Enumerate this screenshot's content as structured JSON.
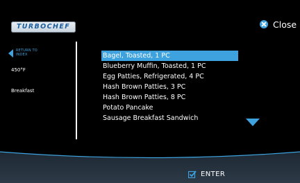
{
  "logo": {
    "text": "TURBOCHEF"
  },
  "close": {
    "label": "Close"
  },
  "sidebar": {
    "back_label": "RETURN TO INDEX",
    "temperature": "450°F",
    "mode": "Breakfast"
  },
  "menu": {
    "items": [
      "Bagel, Toasted, 1 PC",
      "Blueberry Muffin, Toasted, 1 PC",
      "Egg Patties, Refrigerated, 4 PC",
      "Hash Brown Patties, 3 PC",
      "Hash Brown Patties, 8 PC",
      "Potato Pancake",
      "Sausage Breakfast Sandwich"
    ],
    "selected_index": 0
  },
  "footer": {
    "enter_label": "ENTER"
  },
  "colors": {
    "accent": "#3da2dd",
    "background": "#000000",
    "bottom_bar": "#283542"
  }
}
